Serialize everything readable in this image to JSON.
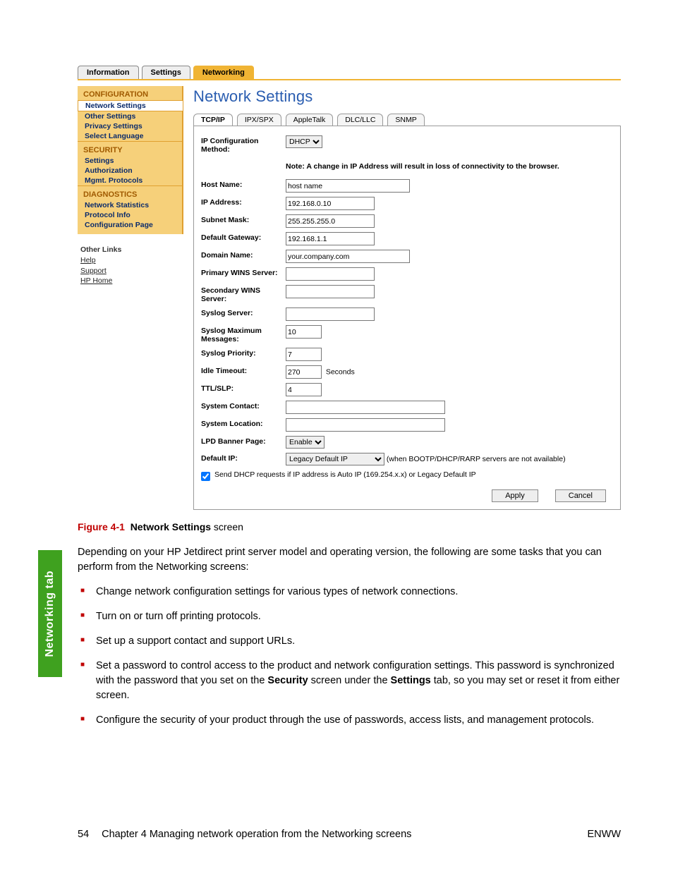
{
  "toptabs": [
    "Information",
    "Settings",
    "Networking"
  ],
  "toptab_active": 2,
  "sidebar": {
    "sections": [
      {
        "title": "CONFIGURATION",
        "items": [
          "Network Settings",
          "Other Settings",
          "Privacy Settings",
          "Select Language"
        ],
        "selected": 0
      },
      {
        "title": "SECURITY",
        "items": [
          "Settings",
          "Authorization",
          "Mgmt. Protocols"
        ],
        "selected": -1
      },
      {
        "title": "DIAGNOSTICS",
        "items": [
          "Network Statistics",
          "Protocol Info",
          "Configuration Page"
        ],
        "selected": -1
      }
    ],
    "other_links_title": "Other Links",
    "other_links": [
      "Help",
      "Support",
      "HP Home"
    ]
  },
  "main": {
    "title": "Network Settings",
    "subtabs": [
      "TCP/IP",
      "IPX/SPX",
      "AppleTalk",
      "DLC/LLC",
      "SNMP"
    ],
    "subtab_active": 0,
    "labels": {
      "ip_config": "IP Configuration Method:",
      "note": "Note: A change in IP Address will result in loss of connectivity to the browser.",
      "host": "Host Name:",
      "ip": "IP Address:",
      "mask": "Subnet Mask:",
      "gw": "Default Gateway:",
      "domain": "Domain Name:",
      "pwins": "Primary WINS Server:",
      "swins": "Secondary WINS Server:",
      "syslog": "Syslog Server:",
      "syslogmax": "Syslog Maximum Messages:",
      "syslogpri": "Syslog Priority:",
      "idle": "Idle Timeout:",
      "idle_unit": "Seconds",
      "ttl": "TTL/SLP:",
      "contact": "System Contact:",
      "location": "System Location:",
      "lpd": "LPD Banner Page:",
      "defip": "Default IP:",
      "defip_hint": "(when BOOTP/DHCP/RARP servers are not available)",
      "dhcp_chk": "Send DHCP requests if IP address is Auto IP (169.254.x.x) or Legacy Default IP"
    },
    "values": {
      "ip_config": "DHCP",
      "host": "host name",
      "ip": "192.168.0.10",
      "mask": "255.255.255.0",
      "gw": "192.168.1.1",
      "domain": "your.company.com",
      "pwins": "",
      "swins": "",
      "syslog": "",
      "syslogmax": "10",
      "syslogpri": "7",
      "idle": "270",
      "ttl": "4",
      "contact": "",
      "location": "",
      "lpd": "Enable",
      "defip": "Legacy Default IP",
      "dhcp_checked": true
    },
    "buttons": {
      "apply": "Apply",
      "cancel": "Cancel"
    }
  },
  "caption": {
    "fig": "Figure 4-1",
    "bold": "Network Settings",
    "rest": " screen"
  },
  "para": "Depending on your HP Jetdirect print server model and operating version, the following are some tasks that you can perform from the Networking screens:",
  "bullets": [
    "Change network configuration settings for various types of network connections.",
    "Turn on or turn off printing protocols.",
    "Set up a support contact and support URLs.",
    {
      "pre": "Set a password to control access to the product and network configuration settings. This password is synchronized with the password that you set on the ",
      "b1": "Security",
      "mid": " screen under the ",
      "b2": "Settings",
      "post": " tab, so you may set or reset it from either screen."
    },
    "Configure the security of your product through the use of passwords, access lists, and management protocols."
  ],
  "greentab": "Networking tab",
  "footer": {
    "page": "54",
    "chapter": "Chapter 4   Managing network operation from the Networking screens",
    "right": "ENWW"
  }
}
